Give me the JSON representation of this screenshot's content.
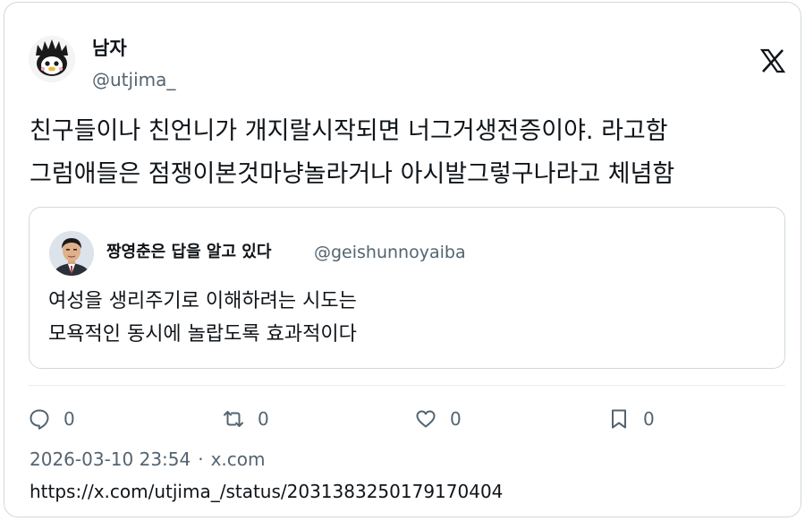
{
  "author": {
    "name": "남자",
    "handle": "@utjima_"
  },
  "tweet": {
    "text": "친구들이나 친언니가 개지랄시작되면 너그거생전증이야. 라고함\n그럼애들은 점쟁이본것마냥놀라거나 아시발그렇구나라고 체념함"
  },
  "quoted": {
    "name": "짱영춘은 답을 알고 있다",
    "handle": "@geishunnoyaiba",
    "text": "여성을 생리주기로 이해하려는 시도는\n모욕적인 동시에 놀랍도록 효과적이다"
  },
  "actions": {
    "reply_count": "0",
    "retweet_count": "0",
    "like_count": "0",
    "bookmark_count": "0"
  },
  "meta": {
    "timestamp": "2026-03-10 23:54",
    "separator": "·",
    "source": "x.com",
    "url": "https://x.com/utjima_/status/2031383250179170404"
  },
  "icons": {
    "brand": "x-logo-icon",
    "reply": "reply-icon",
    "retweet": "retweet-icon",
    "like": "heart-icon",
    "bookmark": "bookmark-icon"
  },
  "colors": {
    "text_primary": "#0f1419",
    "text_secondary": "#536471",
    "border": "#cfd9de"
  }
}
